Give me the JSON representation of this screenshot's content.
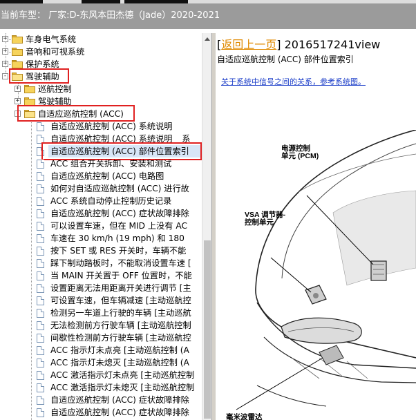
{
  "window": {
    "title": "当前车型： 厂家:D-东风本田杰德（Jade）2020-2021"
  },
  "tree": {
    "items": [
      {
        "label": "车身电气系统",
        "kind": "folder",
        "expander": "+"
      },
      {
        "label": "音响和可视系统",
        "kind": "folder",
        "expander": "+"
      },
      {
        "label": "保护系统",
        "kind": "folder",
        "expander": "+"
      },
      {
        "label": "驾驶辅助",
        "kind": "folder-open",
        "expander": "-"
      },
      {
        "label": "巡航控制",
        "kind": "folder",
        "expander": "+"
      },
      {
        "label": "驾驶辅助",
        "kind": "folder",
        "expander": "+"
      },
      {
        "label": "自适应巡航控制 (ACC)",
        "kind": "folder-open",
        "expander": "-"
      },
      {
        "label": "自适应巡航控制 (ACC) 系统说明",
        "kind": "doc"
      },
      {
        "label": "自适应巡航控制 (ACC) 系统说明 _ 系",
        "kind": "doc"
      },
      {
        "label": "自适应巡航控制 (ACC) 部件位置索引",
        "kind": "doc"
      },
      {
        "label": "ACC 组合开关拆卸、安装和测试",
        "kind": "doc"
      },
      {
        "label": "自适应巡航控制 (ACC) 电路图",
        "kind": "doc"
      },
      {
        "label": "如何对自适应巡航控制 (ACC) 进行故",
        "kind": "doc"
      },
      {
        "label": "ACC 系统自动停止控制历史记录",
        "kind": "doc"
      },
      {
        "label": "自适应巡航控制 (ACC) 症状故障排除",
        "kind": "doc"
      },
      {
        "label": "可以设置车速，但在 MID 上没有 AC",
        "kind": "doc"
      },
      {
        "label": "车速在 30 km/h (19 mph) 和 180",
        "kind": "doc"
      },
      {
        "label": "按下 SET 或 RES 开关时，车辆不能",
        "kind": "doc"
      },
      {
        "label": "踩下制动踏板时，不能取消设置车速 [",
        "kind": "doc"
      },
      {
        "label": "当 MAIN 开关置于 OFF 位置时，不能",
        "kind": "doc"
      },
      {
        "label": "设置距离无法用距离开关进行调节 [主",
        "kind": "doc"
      },
      {
        "label": "可设置车速，但车辆减速 [主动巡航控",
        "kind": "doc"
      },
      {
        "label": "检测另一车道上行驶的车辆 [主动巡航",
        "kind": "doc"
      },
      {
        "label": "无法检测前方行驶车辆 [主动巡航控制",
        "kind": "doc"
      },
      {
        "label": "间歇性检测前方行驶车辆 [主动巡航控",
        "kind": "doc"
      },
      {
        "label": "ACC 指示灯未点亮 [主动巡航控制 (A",
        "kind": "doc"
      },
      {
        "label": "ACC 指示灯未熄灭 [主动巡航控制 (A",
        "kind": "doc"
      },
      {
        "label": "ACC 激活指示灯未点亮 [主动巡航控制",
        "kind": "doc"
      },
      {
        "label": "ACC 激活指示灯未熄灭 [主动巡航控制",
        "kind": "doc"
      },
      {
        "label": "自适应巡航控制 (ACC) 症状故障排除",
        "kind": "doc"
      },
      {
        "label": "自适应巡航控制 (ACC) 症状故障排除",
        "kind": "doc"
      }
    ]
  },
  "content": {
    "nav_open_bracket": "[",
    "back_label": "返回上一页",
    "nav_close_bracket": "]",
    "doc_code": "2016517241view",
    "title": "自适应巡航控制 (ACC) 部件位置索引",
    "system_link": "关于系统中信号之间的关系，参考系统图。",
    "figure_labels": {
      "pcm": [
        "电源控制",
        "单元 (PCM)"
      ],
      "vsa": [
        "VSA 调节器-",
        "控制单元"
      ],
      "bottom": "毫米波雷达"
    }
  }
}
